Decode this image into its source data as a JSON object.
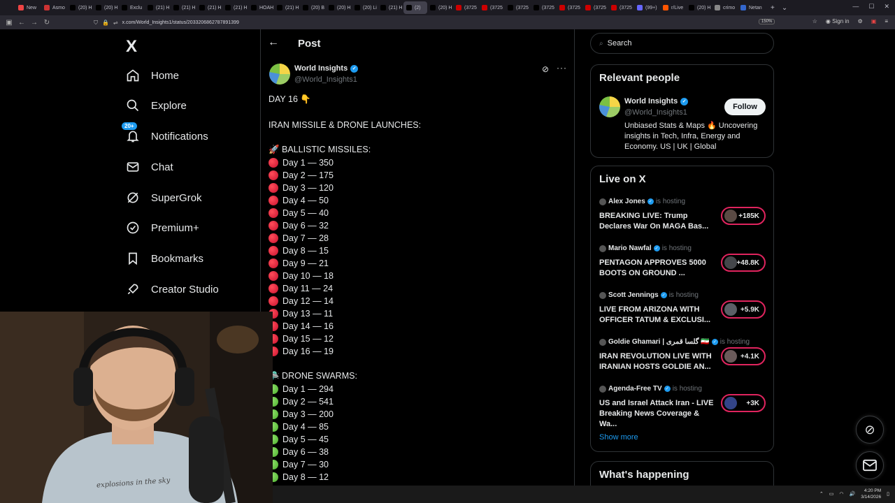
{
  "browser": {
    "tabs": [
      {
        "label": "New",
        "color": "#e44"
      },
      {
        "label": "Asmo",
        "color": "#c33"
      },
      {
        "label": "(20) H",
        "color": "#000"
      },
      {
        "label": "(20) H",
        "color": "#000"
      },
      {
        "label": "Exclu",
        "color": "#000"
      },
      {
        "label": "(21) H",
        "color": "#000"
      },
      {
        "label": "(21) H",
        "color": "#000"
      },
      {
        "label": "(21) H",
        "color": "#000"
      },
      {
        "label": "(21) H",
        "color": "#000"
      },
      {
        "label": "HOAH",
        "color": "#000"
      },
      {
        "label": "(21) H",
        "color": "#000"
      },
      {
        "label": "(20) B",
        "color": "#000"
      },
      {
        "label": "(20) H",
        "color": "#000"
      },
      {
        "label": "(20) Li",
        "color": "#000"
      },
      {
        "label": "(21) H",
        "color": "#000"
      },
      {
        "label": "(2)",
        "color": "#000",
        "active": true
      },
      {
        "label": "(20) H",
        "color": "#000"
      },
      {
        "label": "(3725",
        "color": "#c00"
      },
      {
        "label": "(3725",
        "color": "#c00"
      },
      {
        "label": "(3725",
        "color": "#000"
      },
      {
        "label": "(3725",
        "color": "#000"
      },
      {
        "label": "(3725",
        "color": "#c00"
      },
      {
        "label": "(3725",
        "color": "#c00"
      },
      {
        "label": "(3725",
        "color": "#c00"
      },
      {
        "label": "(99+)",
        "color": "#66f"
      },
      {
        "label": "r/Live",
        "color": "#f50"
      },
      {
        "label": "(20) H",
        "color": "#000"
      },
      {
        "label": "crimo",
        "color": "#888"
      },
      {
        "label": "Netan",
        "color": "#36c"
      }
    ],
    "url": "x.com/World_Insights1/status/2033206862787891399",
    "zoom": "150%",
    "sign_in": "Sign in"
  },
  "nav": {
    "logo": "X",
    "items": [
      {
        "label": "Home",
        "icon": "home-icon"
      },
      {
        "label": "Explore",
        "icon": "search-icon"
      },
      {
        "label": "Notifications",
        "icon": "bell-icon",
        "badge": "20+"
      },
      {
        "label": "Chat",
        "icon": "mail-icon"
      },
      {
        "label": "SuperGrok",
        "icon": "grok-icon"
      },
      {
        "label": "Premium+",
        "icon": "verified-badge-icon"
      },
      {
        "label": "Bookmarks",
        "icon": "bookmark-icon"
      },
      {
        "label": "Creator Studio",
        "icon": "rocket-icon"
      }
    ]
  },
  "post": {
    "header_title": "Post",
    "author_name": "World Insights",
    "author_handle": "@World_Insights1",
    "lines": [
      {
        "text": "DAY 16 👇",
        "kind": "plain"
      },
      {
        "text": "IRAN MISSILE & DRONE LAUNCHES:",
        "kind": "plain"
      },
      {
        "text": "🚀 BALLISTIC MISSILES:",
        "kind": "plain"
      },
      {
        "text": "Day 1 — 350",
        "kind": "red"
      },
      {
        "text": "Day 2 — 175",
        "kind": "red"
      },
      {
        "text": "Day 3 — 120",
        "kind": "red"
      },
      {
        "text": "Day 4 — 50",
        "kind": "red"
      },
      {
        "text": "Day 5 — 40",
        "kind": "red"
      },
      {
        "text": "Day 6 — 32",
        "kind": "red"
      },
      {
        "text": "Day 7 — 28",
        "kind": "red"
      },
      {
        "text": "Day 8 — 15",
        "kind": "red"
      },
      {
        "text": "Day 9 — 21",
        "kind": "red"
      },
      {
        "text": "Day 10 — 18",
        "kind": "red"
      },
      {
        "text": "Day 11 — 24",
        "kind": "red"
      },
      {
        "text": "Day 12 — 14",
        "kind": "red"
      },
      {
        "text": "Day 13 — 11",
        "kind": "red"
      },
      {
        "text": "Day 14 — 16",
        "kind": "red"
      },
      {
        "text": "Day 15 — 12",
        "kind": "red"
      },
      {
        "text": "Day 16 — 19",
        "kind": "red"
      },
      {
        "text": "🛸 DRONE SWARMS:",
        "kind": "plain"
      },
      {
        "text": "Day 1 — 294",
        "kind": "green"
      },
      {
        "text": "Day 2 — 541",
        "kind": "green"
      },
      {
        "text": "Day 3 — 200",
        "kind": "green"
      },
      {
        "text": "Day 4 — 85",
        "kind": "green"
      },
      {
        "text": "Day 5 — 45",
        "kind": "green"
      },
      {
        "text": "Day 6 — 38",
        "kind": "green"
      },
      {
        "text": "Day 7 — 30",
        "kind": "green"
      },
      {
        "text": "Day 8 — 12",
        "kind": "green"
      }
    ]
  },
  "sidebar": {
    "search_placeholder": "Search",
    "relevant": {
      "title": "Relevant people",
      "name": "World Insights",
      "handle": "@World_Insights1",
      "follow": "Follow",
      "bio": "Unbiased Stats & Maps 🔥 Uncovering insights in Tech, Infra, Energy and Economy. US | UK | Global"
    },
    "live": {
      "title": "Live on X",
      "items": [
        {
          "host": "Alex Jones",
          "tag": "is hosting",
          "title": "BREAKING LIVE: Trump Declares War On MAGA Bas...",
          "count": "+185K"
        },
        {
          "host": "Mario Nawfal",
          "tag": "is hosting",
          "title": "PENTAGON APPROVES 5000 BOOTS ON GROUND ...",
          "count": "+48.8K"
        },
        {
          "host": "Scott Jennings",
          "tag": "is hosting",
          "title": "LIVE FROM ARIZONA WITH OFFICER TATUM & EXCLUSI...",
          "count": "+5.9K"
        },
        {
          "host": "Goldie Ghamari | گلسا قمری 🇮🇷",
          "tag": "is hosting",
          "title": "IRAN REVOLUTION LIVE WITH IRANIAN HOSTS GOLDIE AN...",
          "count": "+4.1K"
        },
        {
          "host": "Agenda-Free TV",
          "tag": "is hosting",
          "title": "US and Israel Attack Iran - LIVE Breaking News Coverage & Wa...",
          "count": "+3K"
        }
      ],
      "show_more": "Show more"
    },
    "happening_title": "What's happening"
  },
  "webcam": {
    "shirt_text": "explosions in the sky"
  },
  "taskbar": {
    "time": "4:20 PM",
    "date": "3/14/2026"
  }
}
